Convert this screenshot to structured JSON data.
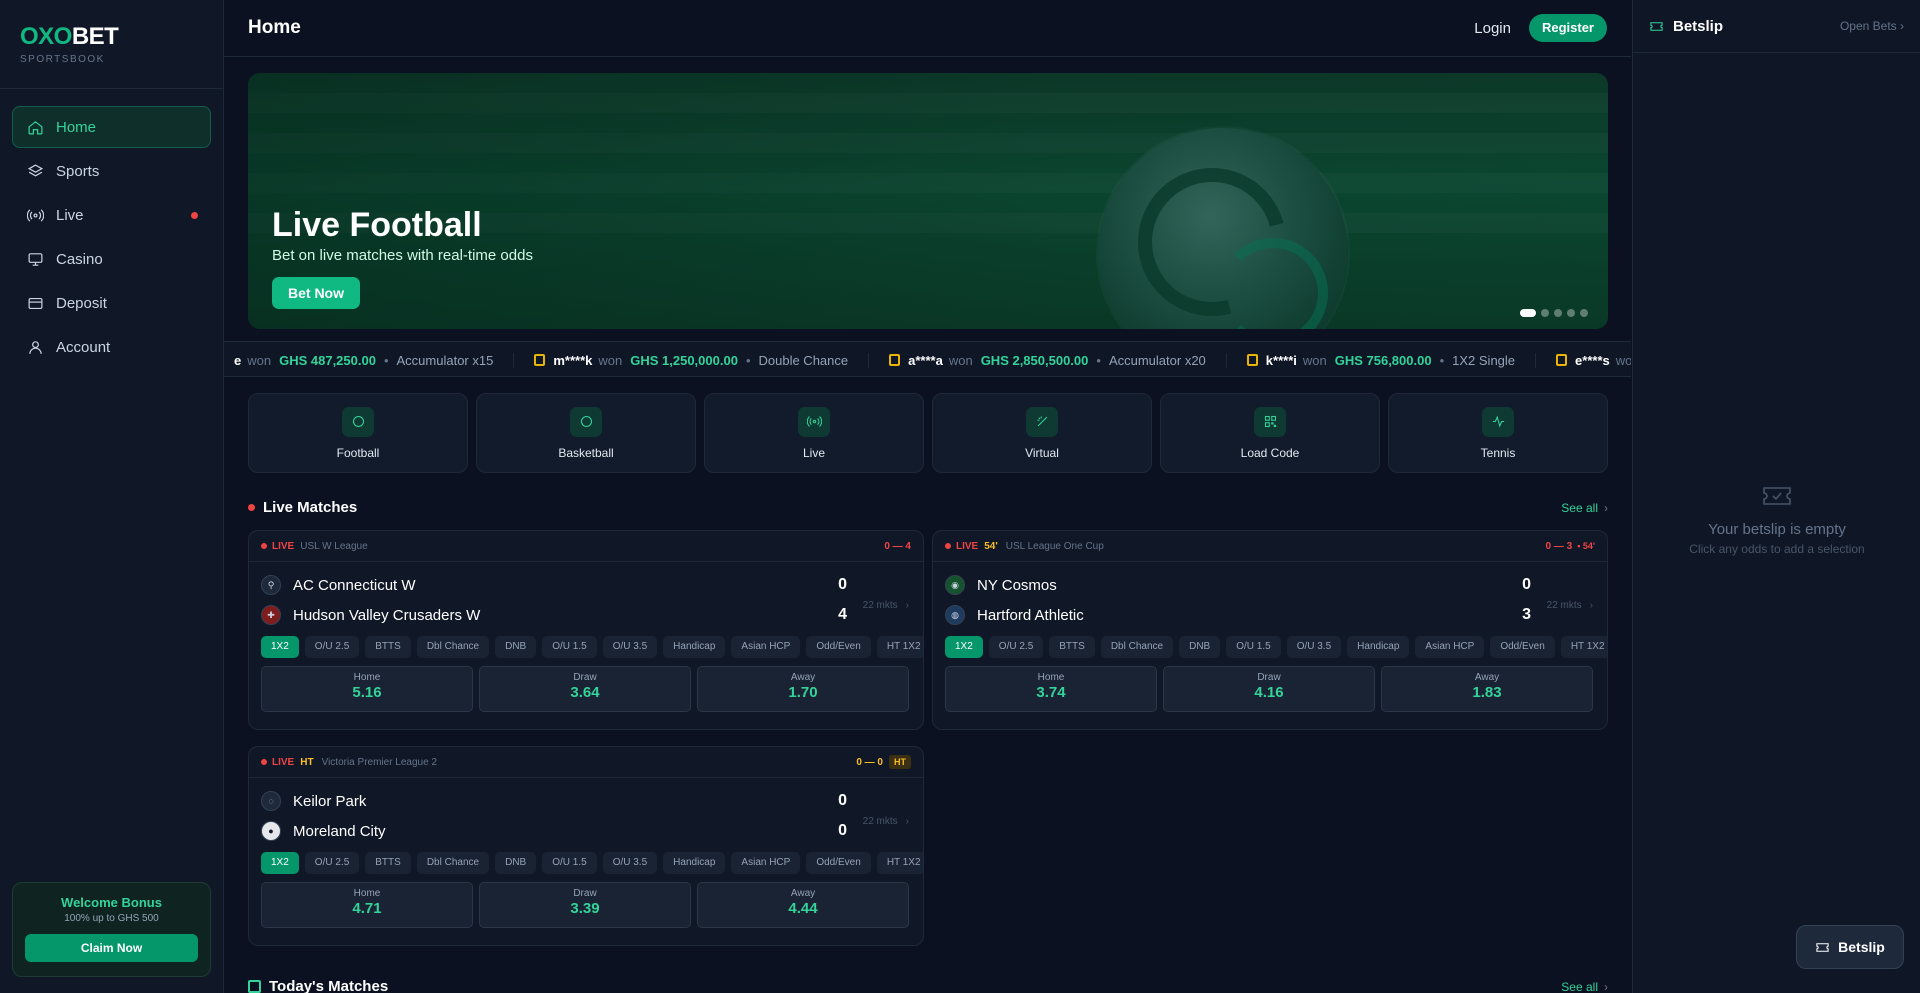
{
  "brand": {
    "name_part1": "OXO",
    "name_part2": "BET",
    "subtitle": "SPORTSBOOK"
  },
  "sidebar": {
    "items": [
      {
        "label": "Home",
        "icon": "home-icon",
        "active": true
      },
      {
        "label": "Sports",
        "icon": "layers-icon"
      },
      {
        "label": "Live",
        "icon": "broadcast-icon",
        "has_dot": true
      },
      {
        "label": "Casino",
        "icon": "monitor-icon"
      },
      {
        "label": "Deposit",
        "icon": "card-icon"
      },
      {
        "label": "Account",
        "icon": "user-icon"
      }
    ],
    "bonus": {
      "title": "Welcome Bonus",
      "subtitle": "100% up to GHS 500",
      "button": "Claim Now"
    }
  },
  "header": {
    "title": "Home",
    "login": "Login",
    "register": "Register"
  },
  "hero": {
    "title": "Live Football",
    "subtitle": "Bet on live matches with real-time odds",
    "button": "Bet Now",
    "slides": 5,
    "active_slide": 1
  },
  "ticker": [
    {
      "user": "",
      "prefix": "e",
      "won": "won",
      "amount": "GHS 487,250.00",
      "type": "Accumulator x15"
    },
    {
      "user": "m****k",
      "won": "won",
      "amount": "GHS 1,250,000.00",
      "type": "Double Chance"
    },
    {
      "user": "a****a",
      "won": "won",
      "amount": "GHS 2,850,500.00",
      "type": "Accumulator x20"
    },
    {
      "user": "k****i",
      "won": "won",
      "amount": "GHS 756,800.00",
      "type": "1X2 Single"
    },
    {
      "user": "e****s",
      "won": "wo",
      "amount": "",
      "type": ""
    }
  ],
  "quick_links": [
    {
      "label": "Football",
      "icon": "circle-icon"
    },
    {
      "label": "Basketball",
      "icon": "circle-icon"
    },
    {
      "label": "Live",
      "icon": "broadcast-icon"
    },
    {
      "label": "Virtual",
      "icon": "wand-icon"
    },
    {
      "label": "Load Code",
      "icon": "qr-code-icon"
    },
    {
      "label": "Tennis",
      "icon": "activity-icon"
    }
  ],
  "live_section": {
    "title": "Live Matches",
    "see_all": "See all"
  },
  "today_section": {
    "title": "Today's Matches",
    "see_all": "See all"
  },
  "market_chips": [
    "1X2",
    "O/U 2.5",
    "BTTS",
    "Dbl Chance",
    "DNB",
    "O/U 1.5",
    "O/U 3.5",
    "Handicap",
    "Asian HCP",
    "Odd/Even",
    "HT 1X2"
  ],
  "matches": [
    {
      "live": "LIVE",
      "minute": "",
      "league": "USL W League",
      "agg": "0 — 4",
      "agg_extra": "",
      "home": "AC Connecticut W",
      "away": "Hudson Valley Crusaders W",
      "home_score": "0",
      "away_score": "4",
      "markets": "22 mkts",
      "odds": {
        "home_label": "Home",
        "home": "5.16",
        "draw_label": "Draw",
        "draw": "3.64",
        "away_label": "Away",
        "away": "1.70"
      }
    },
    {
      "live": "LIVE",
      "minute": "54'",
      "league": "USL League One Cup",
      "agg": "0 — 3",
      "agg_extra": "• 54'",
      "home": "NY Cosmos",
      "away": "Hartford Athletic",
      "home_score": "0",
      "away_score": "3",
      "markets": "22 mkts",
      "odds": {
        "home_label": "Home",
        "home": "3.74",
        "draw_label": "Draw",
        "draw": "4.16",
        "away_label": "Away",
        "away": "1.83"
      }
    },
    {
      "live": "LIVE",
      "minute": "HT",
      "league": "Victoria Premier League 2",
      "agg": "0 — 0",
      "badge": "HT",
      "home": "Keilor Park",
      "away": "Moreland City",
      "home_score": "0",
      "away_score": "0",
      "markets": "22 mkts",
      "odds": {
        "home_label": "Home",
        "home": "4.71",
        "draw_label": "Draw",
        "draw": "3.39",
        "away_label": "Away",
        "away": "4.44"
      }
    }
  ],
  "betslip": {
    "title": "Betslip",
    "open_bets": "Open Bets",
    "empty_title": "Your betslip is empty",
    "empty_sub": "Click any odds to add a selection",
    "float_label": "Betslip"
  },
  "colors": {
    "accent": "#10b981",
    "live": "#ef4444",
    "halftime": "#fbbf24",
    "background": "#0b1120"
  }
}
